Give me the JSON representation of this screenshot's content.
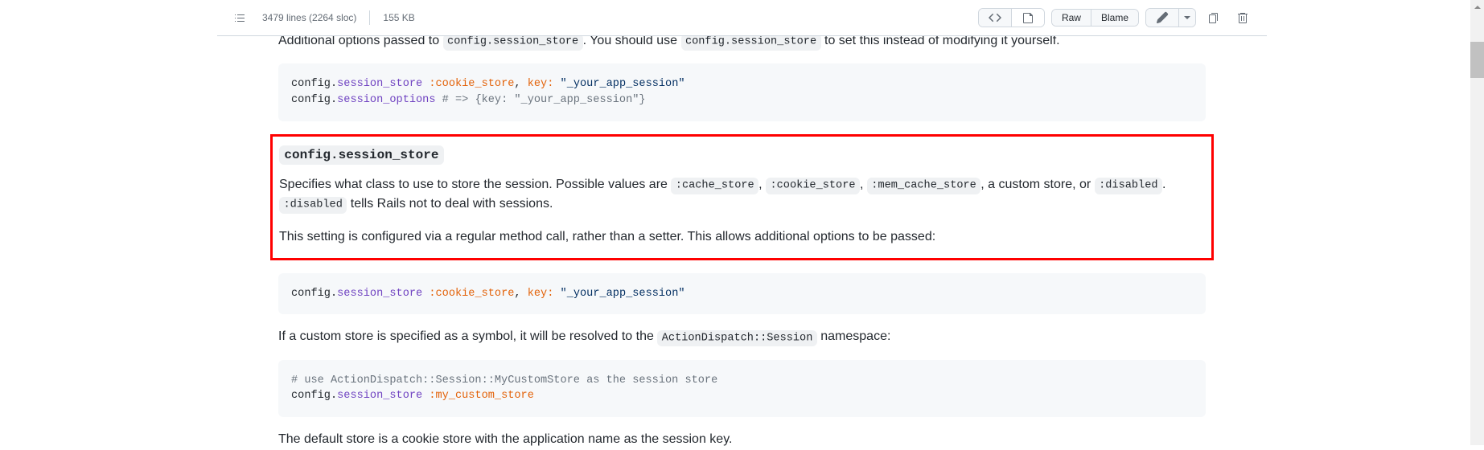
{
  "header": {
    "lines": "3479 lines (2264 sloc)",
    "size": "155 KB",
    "raw": "Raw",
    "blame": "Blame"
  },
  "truncated": {
    "prefix": "Additional options passed to ",
    "code1": "config.session_store",
    "mid": ". You should use ",
    "code2": "config.session_store",
    "suffix": " to set this instead of modifying it yourself."
  },
  "code1": {
    "l1_a": "config",
    "l1_b": ".",
    "l1_c": "session_store",
    "l1_d": " :cookie_store",
    "l1_e": ", ",
    "l1_f": "key: ",
    "l1_g": "\"_your_app_session\"",
    "l2_a": "config",
    "l2_b": ".",
    "l2_c": "session_options",
    "l2_d": " # => {key: \"_your_app_session\"}"
  },
  "highlight": {
    "title_code": "config.session_store",
    "p1_a": "Specifies what class to use to store the session. Possible values are ",
    "p1_code1": ":cache_store",
    "p1_b": ", ",
    "p1_code2": ":cookie_store",
    "p1_c": ", ",
    "p1_code3": ":mem_cache_store",
    "p1_d": ", a custom store, or ",
    "p1_code4": ":disabled",
    "p1_e": ". ",
    "p1_code5": ":disabled",
    "p1_f": " tells Rails not to deal with sessions.",
    "p2": "This setting is configured via a regular method call, rather than a setter. This allows additional options to be passed:"
  },
  "code2": {
    "a": "config",
    "b": ".",
    "c": "session_store",
    "d": " :cookie_store",
    "e": ", ",
    "f": "key: ",
    "g": "\"_your_app_session\""
  },
  "para2": {
    "a": "If a custom store is specified as a symbol, it will be resolved to the ",
    "code": "ActionDispatch::Session",
    "b": " namespace:"
  },
  "code3": {
    "l1": "# use ActionDispatch::Session::MyCustomStore as the session store",
    "l2_a": "config",
    "l2_b": ".",
    "l2_c": "session_store",
    "l2_d": " :my_custom_store"
  },
  "para3": "The default store is a cookie store with the application name as the session key."
}
